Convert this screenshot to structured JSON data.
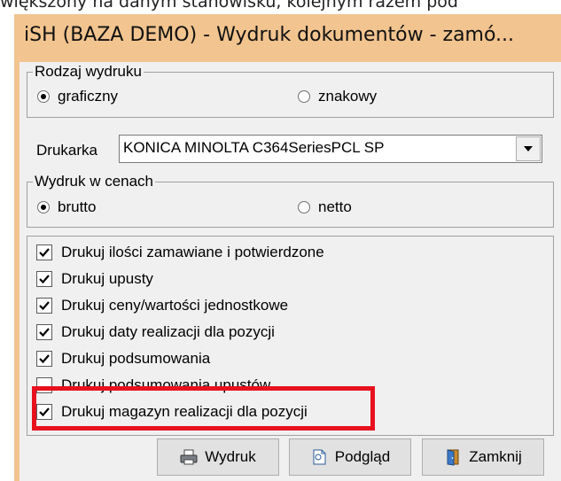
{
  "top_text": "większony na danym stanowisku, kolejnym razem pod",
  "window": {
    "title": "iSH (BAZA DEMO) - Wydruk dokumentów - zamó..."
  },
  "print_type": {
    "legend": "Rodzaj wydruku",
    "options": [
      {
        "label": "graficzny",
        "selected": true
      },
      {
        "label": "znakowy",
        "selected": false
      }
    ]
  },
  "printer": {
    "label": "Drukarka",
    "value": "KONICA MINOLTA C364SeriesPCL SP"
  },
  "prices": {
    "legend": "Wydruk w cenach",
    "options": [
      {
        "label": "brutto",
        "selected": true
      },
      {
        "label": "netto",
        "selected": false
      }
    ]
  },
  "checkboxes": [
    {
      "label": "Drukuj ilości zamawiane i potwierdzone",
      "checked": true
    },
    {
      "label": "Drukuj upusty",
      "checked": true
    },
    {
      "label": "Drukuj ceny/wartości jednostkowe",
      "checked": true
    },
    {
      "label": "Drukuj daty realizacji dla pozycji",
      "checked": true
    },
    {
      "label": "Drukuj podsumowania",
      "checked": true
    },
    {
      "label": "Drukuj podsumowania upustów",
      "checked": false
    },
    {
      "label": "Drukuj magazyn realizacji dla pozycji",
      "checked": true
    }
  ],
  "buttons": {
    "print": "Wydruk",
    "preview": "Podgląd",
    "close": "Zamknij"
  },
  "colors": {
    "titlebar": "#f2c48f",
    "highlight": "#e8111e"
  }
}
